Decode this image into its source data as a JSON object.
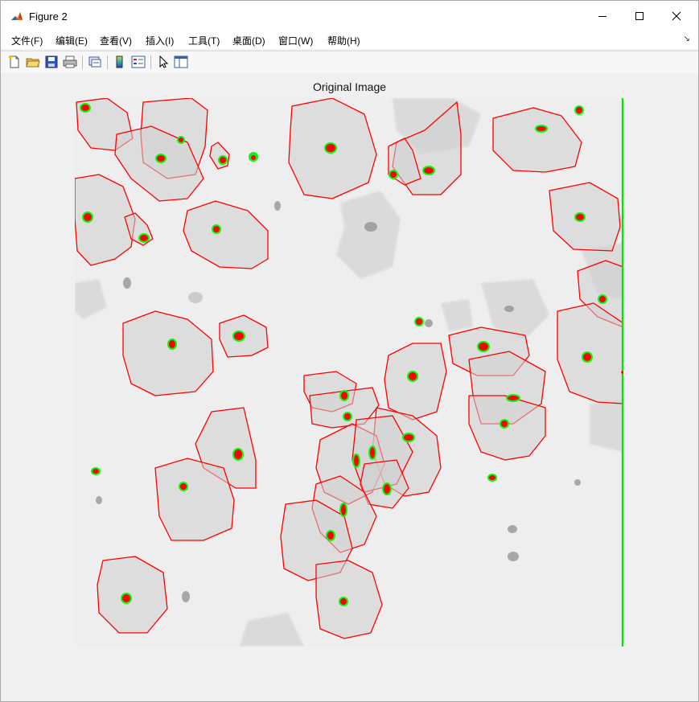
{
  "window": {
    "title": "Figure 2",
    "icon": "matlab-icon",
    "controls": [
      "minimize-icon",
      "maximize-icon",
      "close-icon"
    ]
  },
  "menubar": {
    "items": [
      "文件(F)",
      "编辑(E)",
      "查看(V)",
      "插入(I)",
      "工具(T)",
      "桌面(D)",
      "窗口(W)",
      "帮助(H)"
    ],
    "dock_icon": "undock-arrow-icon"
  },
  "toolbar": {
    "buttons": [
      "new-figure-icon",
      "open-file-icon",
      "save-icon",
      "print-icon",
      "link-icon",
      "colorbar-icon",
      "legend-icon",
      "pointer-icon",
      "property-editor-icon"
    ]
  },
  "figure": {
    "axes_title": "Original Image",
    "colors": {
      "contour": "#ff0000",
      "nucleus_outline": "#00ff00",
      "nucleus_fill": "#ff0000",
      "background": "#f0f0f0"
    }
  }
}
